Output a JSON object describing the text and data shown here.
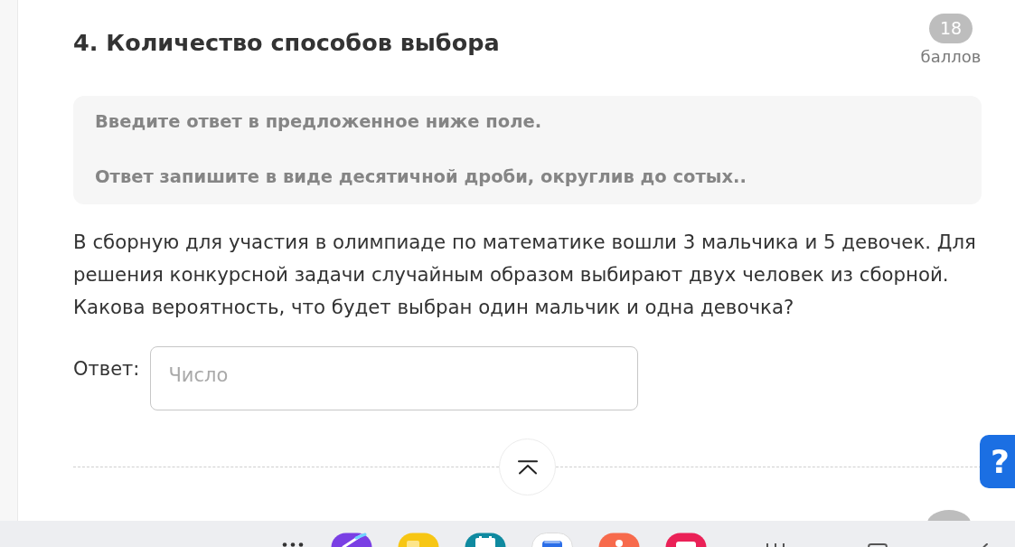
{
  "task": {
    "title": "4. Количество способов выбора",
    "points": {
      "value": "18",
      "unit": "баллов"
    },
    "instructions": [
      "Введите ответ в предложенное ниже поле.",
      "Ответ запишите в виде десятичной дроби, округлив до сотых.."
    ],
    "question": "В сборную для участия в олимпиаде по математике вошли 3 мальчика и 5 девочек. Для решения конкурсной задачи случайным образом выбирают двух человек из сборной. Какова вероятность, что будет выбран один мальчик и одна девочка?",
    "answer": {
      "label": "Ответ:",
      "placeholder": "Число"
    }
  },
  "help_button": {
    "label": "?"
  }
}
